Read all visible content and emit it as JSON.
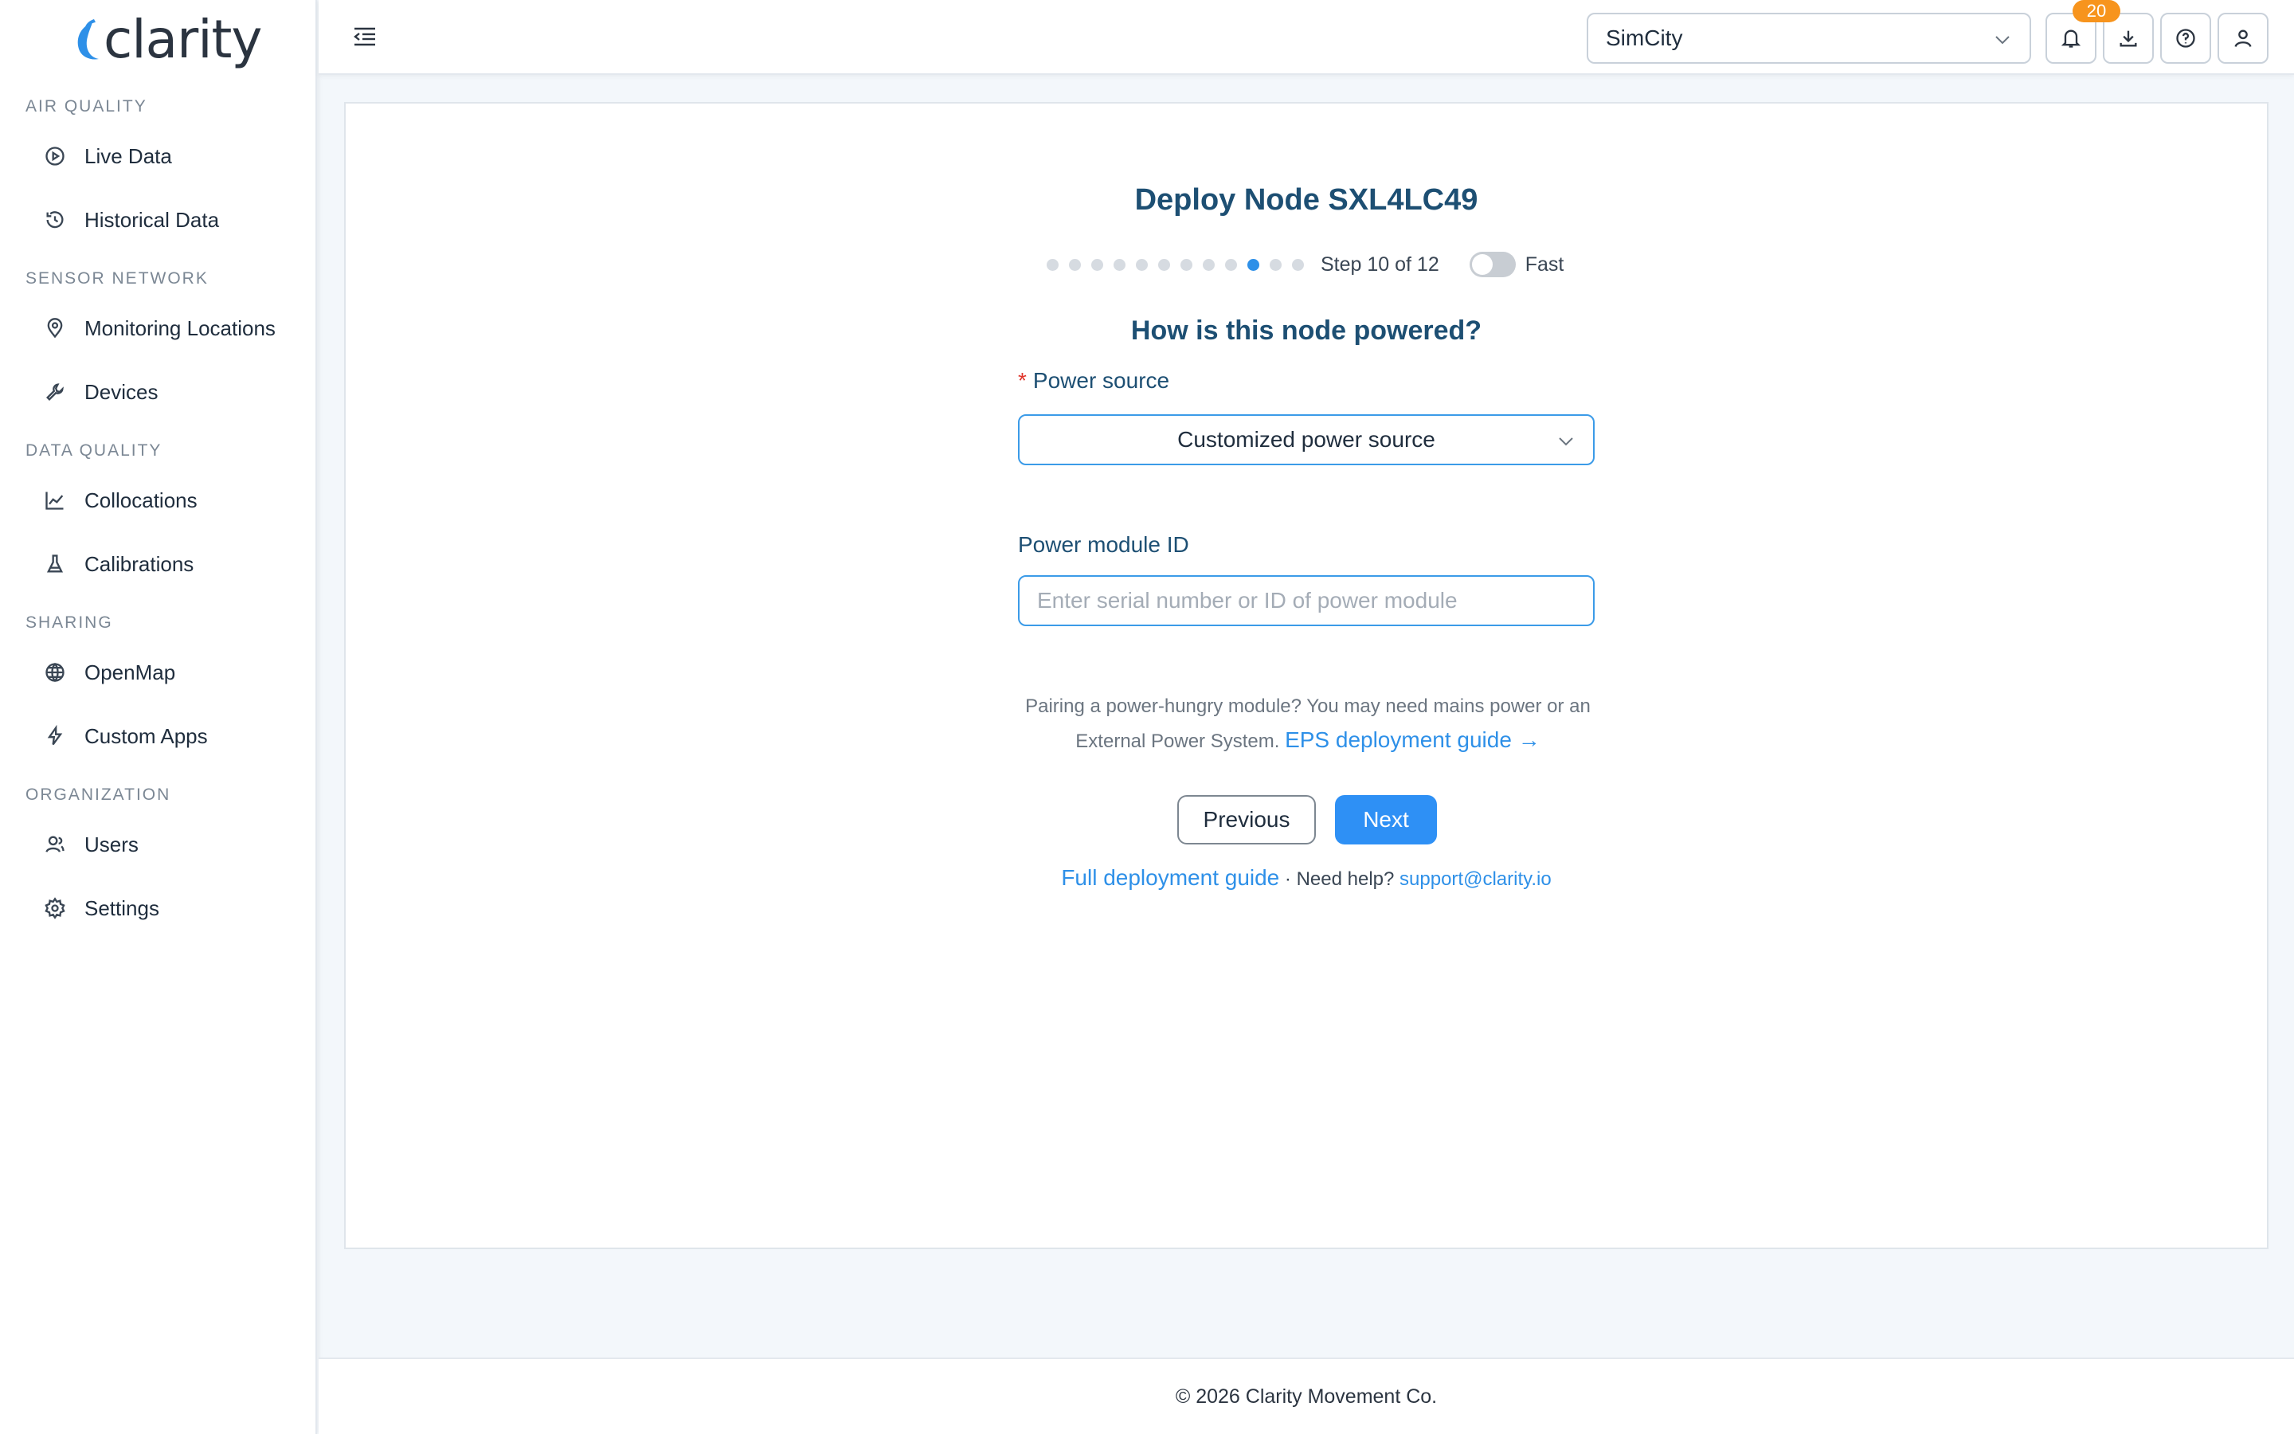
{
  "brand": {
    "name": "clarity",
    "accent": "#2e90e8"
  },
  "sidebar": {
    "sections": [
      {
        "title": "AIR QUALITY",
        "items": [
          {
            "label": "Live Data",
            "icon": "play-circle-icon"
          },
          {
            "label": "Historical Data",
            "icon": "clock-icon"
          }
        ]
      },
      {
        "title": "SENSOR NETWORK",
        "items": [
          {
            "label": "Monitoring Locations",
            "icon": "map-pin-icon"
          },
          {
            "label": "Devices",
            "icon": "wrench-icon"
          }
        ]
      },
      {
        "title": "DATA QUALITY",
        "items": [
          {
            "label": "Collocations",
            "icon": "line-chart-icon"
          },
          {
            "label": "Calibrations",
            "icon": "flask-icon"
          }
        ]
      },
      {
        "title": "SHARING",
        "items": [
          {
            "label": "OpenMap",
            "icon": "globe-icon"
          },
          {
            "label": "Custom Apps",
            "icon": "bolt-icon"
          }
        ]
      },
      {
        "title": "ORGANIZATION",
        "items": [
          {
            "label": "Users",
            "icon": "users-icon"
          },
          {
            "label": "Settings",
            "icon": "gear-icon"
          }
        ]
      }
    ]
  },
  "header": {
    "org_selected": "SimCity",
    "notification_count": "20"
  },
  "wizard": {
    "title": "Deploy Node SXL4LC49",
    "step_text": "Step 10 of 12",
    "current_step": 10,
    "total_steps": 12,
    "fast_label": "Fast",
    "fast_enabled": false,
    "question": "How is this node powered?",
    "power_source_label": "Power source",
    "power_source_value": "Customized power source",
    "module_id_label": "Power module ID",
    "module_id_placeholder": "Enter serial number or ID of power module",
    "module_id_value": "",
    "hint_line1": "Pairing a power-hungry module? You may need mains power or an",
    "hint_line2": "External Power System.",
    "hint_link": "EPS deployment guide →",
    "previous_label": "Previous",
    "next_label": "Next",
    "full_guide_link": "Full deployment guide",
    "help_separator": " · Need help? ",
    "support_email": "support@clarity.io"
  },
  "footer": {
    "copyright": "© 2026 Clarity Movement Co."
  }
}
